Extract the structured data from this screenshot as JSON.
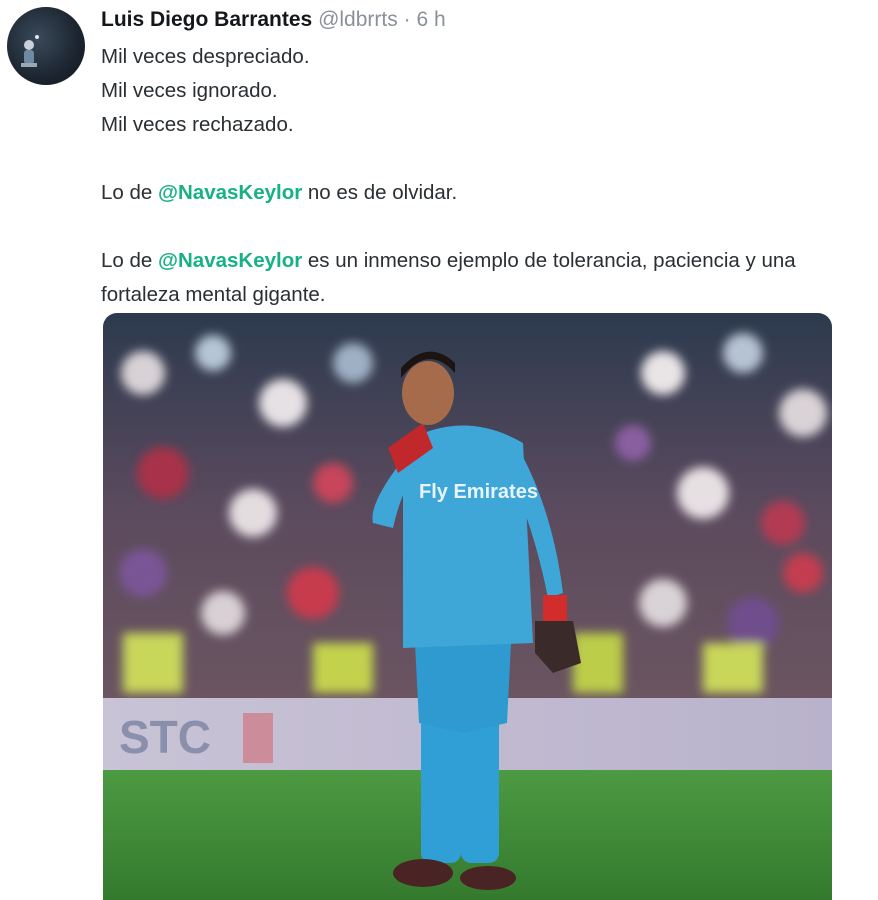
{
  "tweet": {
    "author_name": "Luis Diego Barrantes",
    "handle": "@ldbrrts",
    "separator": "·",
    "time": "6 h",
    "lines": {
      "l1": "Mil veces despreciado.",
      "l2": "Mil veces ignorado.",
      "l3": "Mil veces rechazado.",
      "p2_prefix": "Lo de ",
      "p2_mention": "@NavasKeylor",
      "p2_suffix": " no es de olvidar.",
      "p3_prefix": "Lo de ",
      "p3_mention": "@NavasKeylor",
      "p3_suffix": " es un inmenso ejemplo de tolerancia, paciencia y una fortaleza mental gigante."
    },
    "photo": {
      "jersey_sponsor": "Fly Emirates",
      "board_text": "STC"
    }
  },
  "colors": {
    "mention": "#17b187",
    "jersey": "#3fa6d8",
    "pitch": "#3f8f3a"
  }
}
